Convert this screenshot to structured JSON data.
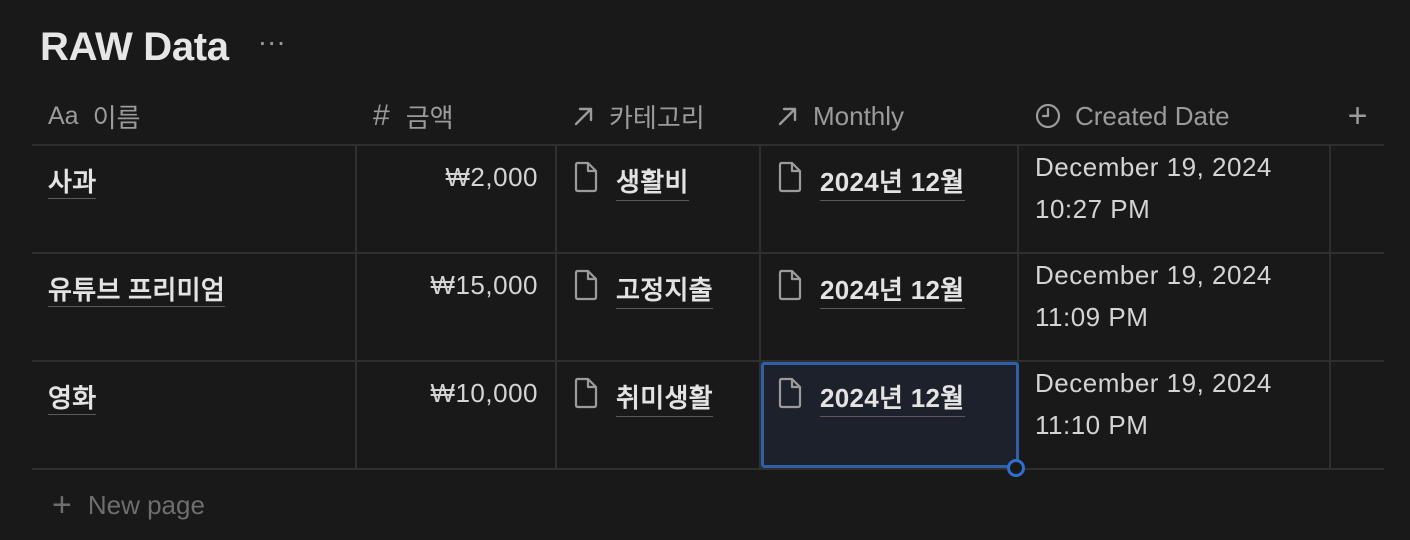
{
  "page": {
    "title": "RAW Data",
    "more_label": "···"
  },
  "table": {
    "columns": [
      {
        "icon": "text-type-icon",
        "icon_text": "Aa",
        "label": "이름"
      },
      {
        "icon": "number-type-icon",
        "icon_text": "#",
        "label": "금액"
      },
      {
        "icon": "relation-arrow-icon",
        "label": "카테고리"
      },
      {
        "icon": "relation-arrow-icon",
        "label": "Monthly"
      },
      {
        "icon": "clock-icon",
        "label": "Created Date"
      }
    ],
    "add_column_label": "+",
    "rows": [
      {
        "name": "사과",
        "amount": "₩2,000",
        "category": "생활비",
        "monthly": "2024년 12월",
        "date_line1": "December 19, 2024",
        "date_line2": "10:27 PM"
      },
      {
        "name": "유튜브 프리미엄",
        "amount": "₩15,000",
        "category": "고정지출",
        "monthly": "2024년 12월",
        "date_line1": "December 19, 2024",
        "date_line2": "11:09 PM"
      },
      {
        "name": "영화",
        "amount": "₩10,000",
        "category": "취미생활",
        "monthly": "2024년 12월",
        "date_line1": "December 19, 2024",
        "date_line2": "11:10 PM"
      }
    ],
    "new_page_icon": "+",
    "new_page_label": "New page"
  },
  "colors": {
    "background": "#191919",
    "text": "#d4d4d4",
    "muted": "#9b9b9b",
    "border": "#2f2f2f",
    "selection": "#2f5fa6"
  }
}
